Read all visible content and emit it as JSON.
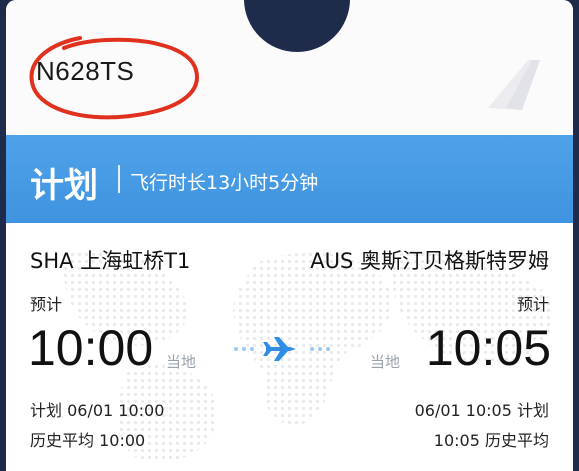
{
  "registration": "N628TS",
  "banner": {
    "status": "计划",
    "duration": "飞行时长13小时5分钟"
  },
  "departure": {
    "code_name": "SHA 上海虹桥T1",
    "estimate_label": "预计",
    "time": "10:00",
    "local_label": "当地",
    "planned": "计划 06/01 10:00",
    "history_avg": "历史平均 10:00"
  },
  "arrival": {
    "code_name": "AUS 奥斯汀贝格斯特罗姆",
    "estimate_label": "预计",
    "time": "10:05",
    "local_label": "当地",
    "planned": "06/01 10:05 计划",
    "history_avg": "10:05 历史平均"
  },
  "icons": {
    "plane": "airplane-icon",
    "tail": "tail-fin-icon"
  },
  "colors": {
    "banner": "#4a9ee6",
    "accent": "#2f8de4",
    "annotation_circle": "#e0301e"
  }
}
